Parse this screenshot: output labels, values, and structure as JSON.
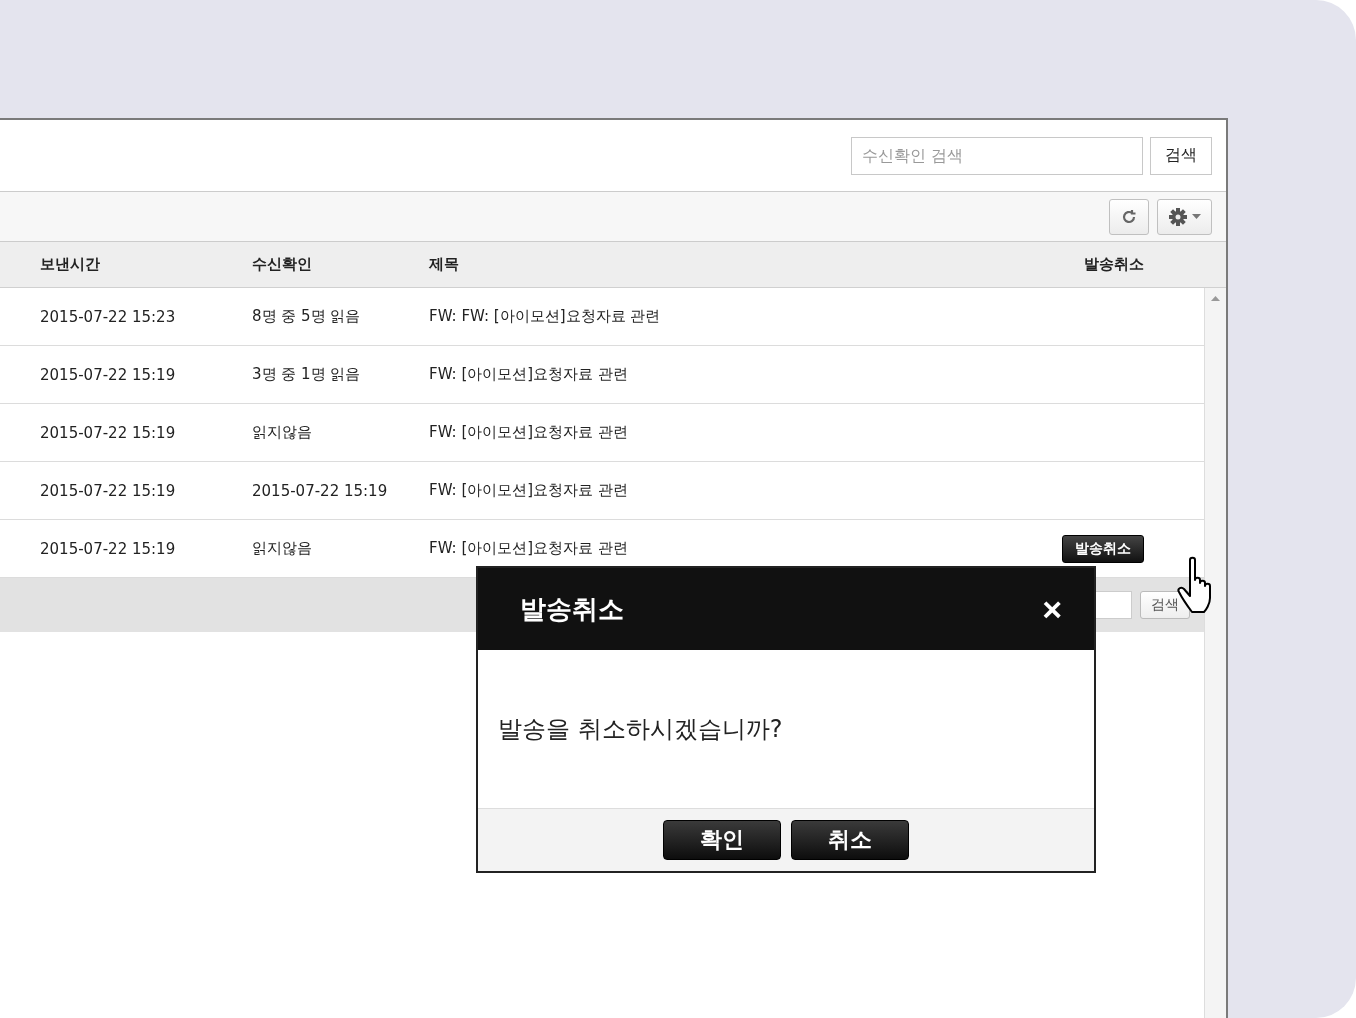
{
  "search": {
    "placeholder": "수신확인 검색",
    "button": "검색"
  },
  "table": {
    "columns": [
      "보낸시간",
      "수신확인",
      "제목",
      "발송취소"
    ],
    "rows": [
      {
        "sent": "2015-07-22 15:23",
        "receipt": "8명 중 5명 읽음",
        "subject": "FW: FW: [아이모션]요청자료 관련"
      },
      {
        "sent": "2015-07-22 15:19",
        "receipt": "3명 중 1명 읽음",
        "subject": "FW: [아이모션]요청자료 관련"
      },
      {
        "sent": "2015-07-22 15:19",
        "receipt": "읽지않음",
        "subject": "FW: [아이모션]요청자료 관련"
      },
      {
        "sent": "2015-07-22 15:19",
        "receipt": "2015-07-22 15:19",
        "subject": "FW: [아이모션]요청자료 관련"
      },
      {
        "sent": "2015-07-22 15:19",
        "receipt": "읽지않음",
        "subject": "FW: [아이모션]요청자료 관련",
        "action": "발송취소"
      }
    ]
  },
  "pager": {
    "button": "검색"
  },
  "dialog": {
    "title": "발송취소",
    "close": "×",
    "message": "발송을 취소하시겠습니까?",
    "buttons": [
      "확인",
      "취소"
    ]
  }
}
